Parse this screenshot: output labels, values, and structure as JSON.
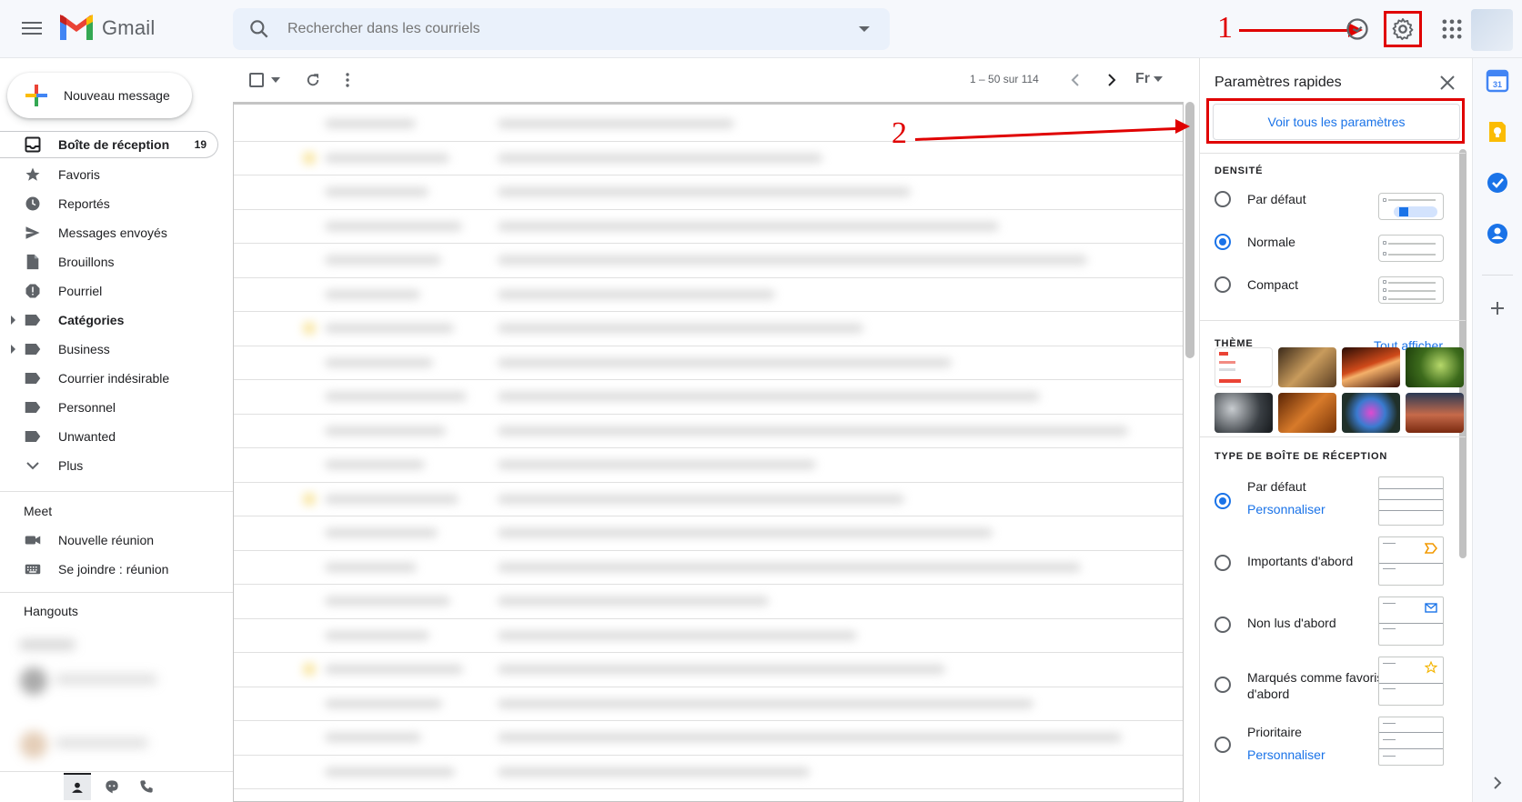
{
  "app": {
    "name": "Gmail"
  },
  "search": {
    "placeholder": "Rechercher dans les courriels"
  },
  "annotations": {
    "one": "1",
    "two": "2"
  },
  "compose": {
    "label": "Nouveau message"
  },
  "nav": {
    "items": [
      {
        "label": "Boîte de réception",
        "count": "19"
      },
      {
        "label": "Favoris"
      },
      {
        "label": "Reportés"
      },
      {
        "label": "Messages envoyés"
      },
      {
        "label": "Brouillons"
      },
      {
        "label": "Pourriel"
      },
      {
        "label": "Catégories"
      },
      {
        "label": "Business"
      },
      {
        "label": "Courrier indésirable"
      },
      {
        "label": "Personnel"
      },
      {
        "label": "Unwanted"
      },
      {
        "label": "Plus"
      }
    ]
  },
  "meet": {
    "title": "Meet",
    "new_meeting": "Nouvelle réunion",
    "join": "Se joindre : réunion"
  },
  "hangouts": {
    "title": "Hangouts"
  },
  "toolbar": {
    "pager": "1 – 50 sur 114",
    "input_tool": "Fr"
  },
  "quick_settings": {
    "title": "Paramètres rapides",
    "see_all": "Voir tous les paramètres",
    "density": {
      "title": "DENSITÉ",
      "options": [
        {
          "label": "Par défaut",
          "selected": false
        },
        {
          "label": "Normale",
          "selected": true
        },
        {
          "label": "Compact",
          "selected": false
        }
      ]
    },
    "theme": {
      "title": "THÈME",
      "link": "Tout afficher"
    },
    "inbox_type": {
      "title": "TYPE DE BOÎTE DE RÉCEPTION",
      "options": [
        {
          "label": "Par défaut",
          "link": "Personnaliser",
          "selected": true
        },
        {
          "label": "Importants d'abord",
          "selected": false
        },
        {
          "label": "Non lus d'abord",
          "selected": false
        },
        {
          "label": "Marqués comme favoris d'abord",
          "selected": false
        },
        {
          "label": "Prioritaire",
          "link": "Personnaliser",
          "selected": false
        }
      ]
    }
  },
  "colors": {
    "accent": "#1a73e8",
    "annotation": "#e00000",
    "icon": "#5f6368"
  }
}
